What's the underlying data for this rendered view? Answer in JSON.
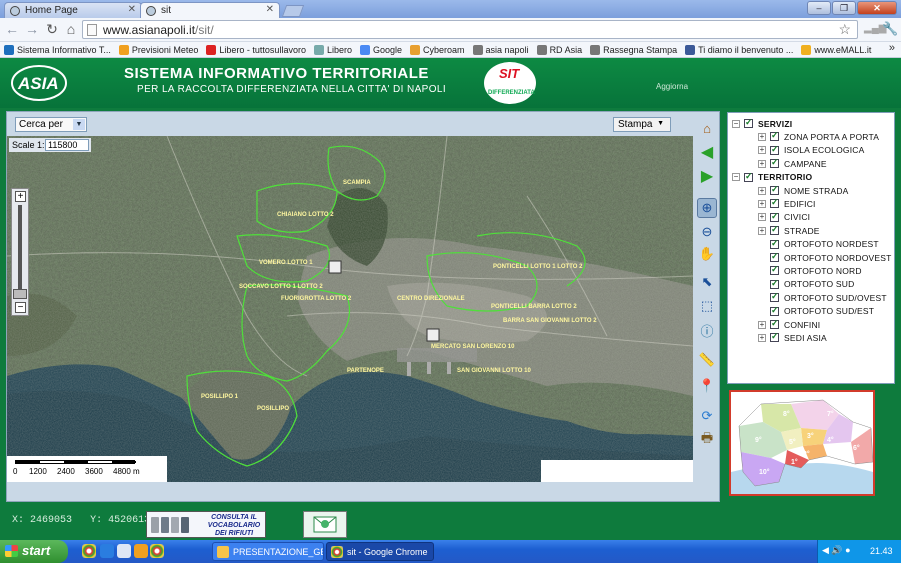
{
  "browser": {
    "tabs": [
      {
        "label": "Home Page",
        "active": false
      },
      {
        "label": "sit",
        "active": true
      }
    ],
    "url_host": "www.asianapoli.it",
    "url_path": "/sit/",
    "bookmarks": [
      {
        "label": "Sistema Informativo T...",
        "color": "#1e6fbd"
      },
      {
        "label": "Previsioni Meteo",
        "color": "#f0a020"
      },
      {
        "label": "Libero - tuttosullavoro",
        "color": "#d22"
      },
      {
        "label": "Libero",
        "color": "#7aa"
      },
      {
        "label": "Google",
        "color": "#4a8af4"
      },
      {
        "label": "Cyberoam",
        "color": "#e8a030"
      },
      {
        "label": "asia napoli",
        "color": "#777"
      },
      {
        "label": "RD Asia",
        "color": "#777"
      },
      {
        "label": "Rassegna Stampa",
        "color": "#777"
      },
      {
        "label": "Ti diamo il benvenuto ...",
        "color": "#3b5998"
      },
      {
        "label": "www.eMALL.it",
        "color": "#f0b020"
      }
    ],
    "bookmarks_more": "»"
  },
  "header": {
    "logo_text": "ASIA",
    "title": "SISTEMA INFORMATIVO TERRITORIALE",
    "subtitle": "PER LA RACCOLTA DIFFERENZIATA NELLA CITTA' DI NAPOLI",
    "sit_logo_top": "SIT",
    "sit_logo_bottom": "DIFFERENZIATA",
    "update_label": "Aggiorna"
  },
  "map": {
    "search_select": "Cerca per",
    "print_select": "Stampa",
    "scale_label": "Scale 1:",
    "scale_value": "115800",
    "scalebar_ticks": [
      "0",
      "1200",
      "2400",
      "3600",
      "4800 m"
    ],
    "labels": [
      "SCAMPIA",
      "CHIAIANO LOTTO 2",
      "VOMERO LOTTO 1",
      "SOCCAVO LOTTO 1 LOTTO 2",
      "FUORIGROTTA LOTTO 2",
      "CENTRO DIREZIONALE",
      "PONTICELLI LOTTO 1 LOTTO 2",
      "PONTICELLI BARRA LOTTO 2",
      "BARRA SAN GIOVANNI LOTTO 2",
      "MERCATO SAN LORENZO 10",
      "SAN GIOVANNI LOTTO 10",
      "PARTENOPE",
      "POSILLIPO 1",
      "POSILLIPO"
    ]
  },
  "tools": [
    {
      "name": "home-tool",
      "icon": "home-icon"
    },
    {
      "name": "back-tool",
      "icon": "arrow-left-icon"
    },
    {
      "name": "forward-tool",
      "icon": "arrow-right-icon"
    },
    {
      "name": "zoom-in-tool",
      "icon": "zoom-in-icon"
    },
    {
      "name": "zoom-out-tool",
      "icon": "zoom-out-icon"
    },
    {
      "name": "pan-tool",
      "icon": "hand-icon"
    },
    {
      "name": "select-tool",
      "icon": "select-icon"
    },
    {
      "name": "select-area-tool",
      "icon": "select-area-icon"
    },
    {
      "name": "info-tool",
      "icon": "info-icon"
    },
    {
      "name": "measure-tool",
      "icon": "ruler-icon"
    },
    {
      "name": "locate-tool",
      "icon": "pin-icon"
    },
    {
      "name": "refresh-tool",
      "icon": "refresh-icon"
    },
    {
      "name": "print-tool",
      "icon": "printer-icon"
    }
  ],
  "layers": [
    {
      "label": "SERVIZI",
      "level": 0,
      "bold": true,
      "expander": "−"
    },
    {
      "label": "ZONA PORTA A PORTA",
      "level": 1,
      "bold": false,
      "expander": "+"
    },
    {
      "label": "ISOLA ECOLOGICA",
      "level": 1,
      "bold": false,
      "expander": "+"
    },
    {
      "label": "CAMPANE",
      "level": 1,
      "bold": false,
      "expander": "+"
    },
    {
      "label": "TERRITORIO",
      "level": 0,
      "bold": true,
      "expander": "−"
    },
    {
      "label": "NOME STRADA",
      "level": 1,
      "bold": false,
      "expander": "+"
    },
    {
      "label": "EDIFICI",
      "level": 1,
      "bold": false,
      "expander": "+"
    },
    {
      "label": "CIVICI",
      "level": 1,
      "bold": false,
      "expander": "+"
    },
    {
      "label": "STRADE",
      "level": 1,
      "bold": false,
      "expander": "+"
    },
    {
      "label": "ORTOFOTO NORDEST",
      "level": 1,
      "bold": false,
      "expander": ""
    },
    {
      "label": "ORTOFOTO NORDOVEST",
      "level": 1,
      "bold": false,
      "expander": ""
    },
    {
      "label": "ORTOFOTO NORD",
      "level": 1,
      "bold": false,
      "expander": ""
    },
    {
      "label": "ORTOFOTO SUD",
      "level": 1,
      "bold": false,
      "expander": ""
    },
    {
      "label": "ORTOFOTO SUD/OVEST",
      "level": 1,
      "bold": false,
      "expander": ""
    },
    {
      "label": "ORTOFOTO SUD/EST",
      "level": 1,
      "bold": false,
      "expander": ""
    },
    {
      "label": "CONFINI",
      "level": 1,
      "bold": false,
      "expander": "+"
    },
    {
      "label": "SEDI ASIA",
      "level": 1,
      "bold": false,
      "expander": "+"
    }
  ],
  "minimap": {
    "districts": [
      "7°",
      "8°",
      "3°",
      "4°",
      "5°",
      "9°",
      "2°",
      "6°",
      "1°",
      "10°"
    ]
  },
  "footer": {
    "x_label": "X:",
    "x_value": "2469053",
    "y_label": "Y:",
    "y_value": "4520613",
    "vocab_line1": "CONSULTA IL",
    "vocab_line2": "VOCABOLARIO",
    "vocab_line3": "DEI RIFIUTI"
  },
  "taskbar": {
    "start": "start",
    "tasks": [
      {
        "label": "PRESENTAZIONE_GE...",
        "active": false
      },
      {
        "label": "sit - Google Chrome",
        "active": true
      }
    ],
    "clock": "21.43"
  },
  "colors": {
    "brand_green": "#0e7b3d",
    "layer_check": "#187a2a",
    "minimap_border": "#d23b2b"
  }
}
